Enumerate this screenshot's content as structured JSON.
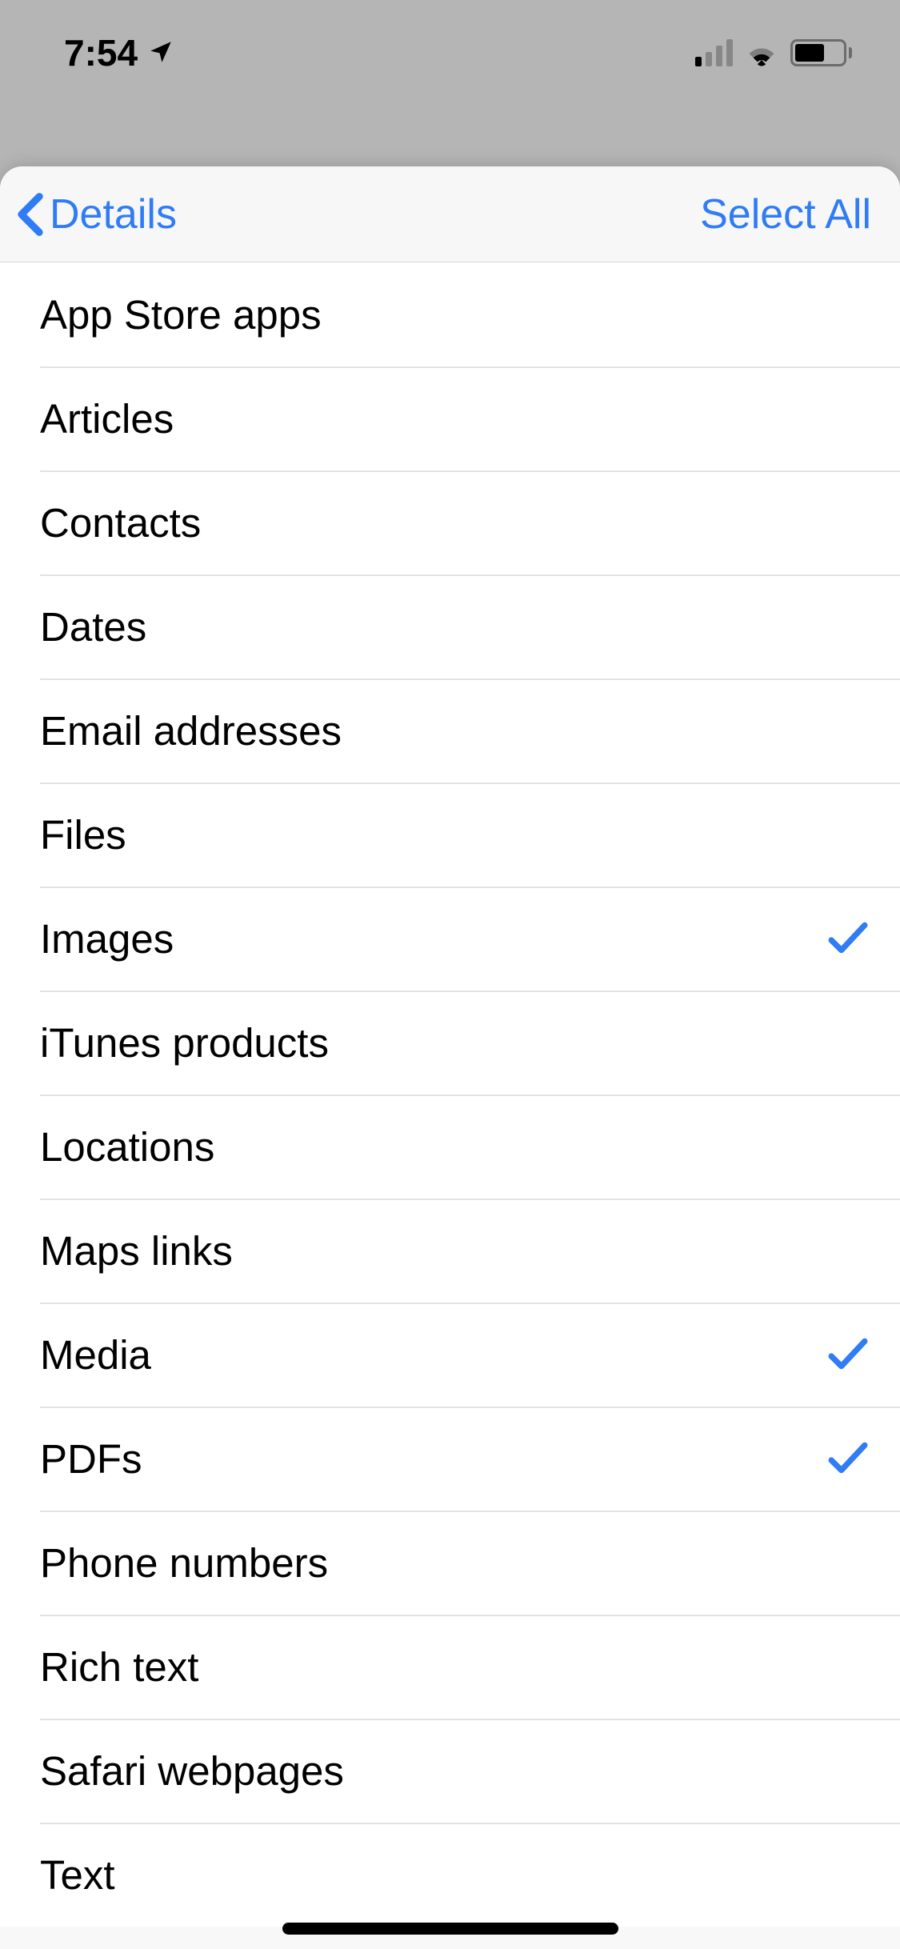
{
  "status": {
    "time": "7:54"
  },
  "nav": {
    "back_label": "Details",
    "select_all_label": "Select All"
  },
  "list": {
    "items": [
      {
        "label": "App Store apps",
        "selected": false
      },
      {
        "label": "Articles",
        "selected": false
      },
      {
        "label": "Contacts",
        "selected": false
      },
      {
        "label": "Dates",
        "selected": false
      },
      {
        "label": "Email addresses",
        "selected": false
      },
      {
        "label": "Files",
        "selected": false
      },
      {
        "label": "Images",
        "selected": true
      },
      {
        "label": "iTunes products",
        "selected": false
      },
      {
        "label": "Locations",
        "selected": false
      },
      {
        "label": "Maps links",
        "selected": false
      },
      {
        "label": "Media",
        "selected": true
      },
      {
        "label": "PDFs",
        "selected": true
      },
      {
        "label": "Phone numbers",
        "selected": false
      },
      {
        "label": "Rich text",
        "selected": false
      },
      {
        "label": "Safari webpages",
        "selected": false
      },
      {
        "label": "Text",
        "selected": false
      }
    ]
  }
}
